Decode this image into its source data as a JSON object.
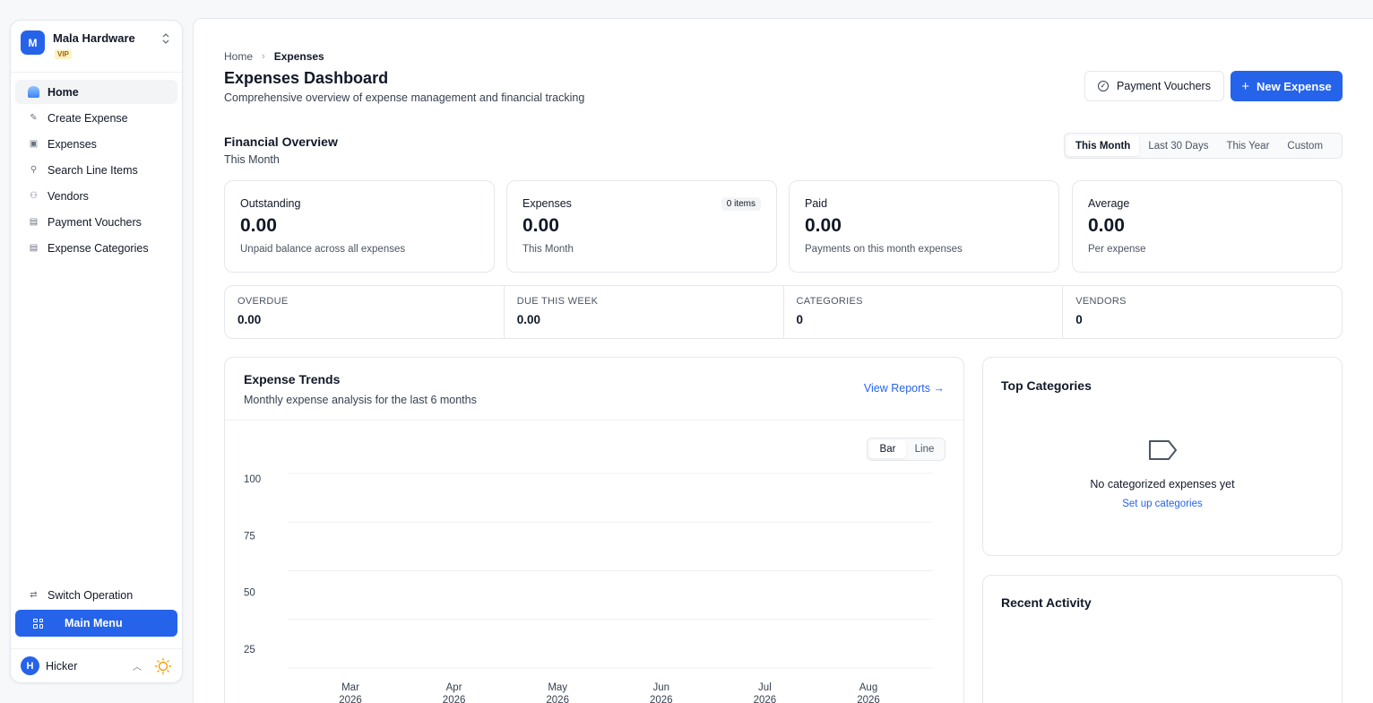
{
  "sidebar": {
    "org": {
      "initial": "M",
      "name": "Mala Hardware",
      "badge": "VIP"
    },
    "items": [
      {
        "label": "Home",
        "icon": "home-icon"
      },
      {
        "label": "Create Expense",
        "icon": "edit-icon"
      },
      {
        "label": "Expenses",
        "icon": "box-icon"
      },
      {
        "label": "Search Line Items",
        "icon": "search-icon"
      },
      {
        "label": "Vendors",
        "icon": "users-icon"
      },
      {
        "label": "Payment Vouchers",
        "icon": "archive-icon"
      },
      {
        "label": "Expense Categories",
        "icon": "archive-icon"
      }
    ],
    "switch_operation": "Switch Operation",
    "main_menu": "Main Menu",
    "user": {
      "initial": "H",
      "name": "Hicker"
    }
  },
  "breadcrumb": {
    "home": "Home",
    "current": "Expenses"
  },
  "header": {
    "title": "Expenses Dashboard",
    "subtitle": "Comprehensive overview of expense management and financial tracking",
    "vouchers_button": "Payment Vouchers",
    "new_button": "New Expense"
  },
  "overview": {
    "title": "Financial Overview",
    "period": "This Month",
    "tabs": [
      "This Month",
      "Last 30 Days",
      "This Year",
      "Custom"
    ],
    "cards": [
      {
        "label": "Outstanding",
        "value": "0.00",
        "note": "Unpaid balance across all expenses"
      },
      {
        "label": "Expenses",
        "value": "0.00",
        "note": "This Month",
        "badge": "0 items"
      },
      {
        "label": "Paid",
        "value": "0.00",
        "note": "Payments on this month expenses"
      },
      {
        "label": "Average",
        "value": "0.00",
        "note": "Per expense"
      }
    ],
    "mini": [
      {
        "label": "OVERDUE",
        "value": "0.00"
      },
      {
        "label": "DUE THIS WEEK",
        "value": "0.00"
      },
      {
        "label": "CATEGORIES",
        "value": "0"
      },
      {
        "label": "VENDORS",
        "value": "0"
      }
    ]
  },
  "trends": {
    "title": "Expense Trends",
    "subtitle": "Monthly expense analysis for the last 6 months",
    "link": "View Reports →",
    "toggle": [
      "Bar",
      "Line"
    ]
  },
  "chart_data": {
    "type": "bar",
    "categories": [
      "Mar 2026",
      "Apr 2026",
      "May 2026",
      "Jun 2026",
      "Jul 2026",
      "Aug 2026"
    ],
    "month_labels": [
      "Mar",
      "Apr",
      "May",
      "Jun",
      "Jul",
      "Aug"
    ],
    "year_labels": [
      "2026",
      "2026",
      "2026",
      "2026",
      "2026",
      "2026"
    ],
    "values": [
      0,
      0,
      0,
      0,
      0,
      0
    ],
    "yticks": [
      100,
      75,
      50,
      25
    ],
    "ylim": [
      0,
      100
    ],
    "grid": true
  },
  "categories_card": {
    "title": "Top Categories",
    "empty": "No categorized expenses yet",
    "link": "Set up categories"
  },
  "activity_card": {
    "title": "Recent Activity"
  },
  "colors": {
    "accent": "#2563eb",
    "badge": "#fef3c7"
  }
}
